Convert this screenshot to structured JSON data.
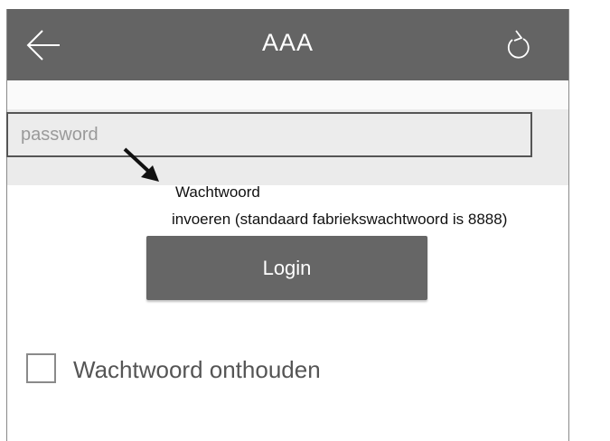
{
  "topbar": {
    "title": "AAA",
    "back_icon": "arrow-left-icon",
    "refresh_icon": "refresh-icon",
    "background": "#646464"
  },
  "password_field": {
    "placeholder": "password",
    "value": ""
  },
  "annotation": {
    "line1": "Wachtwoord",
    "line2": "invoeren (standaard fabriekswachtwoord is 8888)",
    "arrow_icon": "arrow-down-right-icon"
  },
  "login_button": {
    "label": "Login",
    "color": "#666666"
  },
  "remember": {
    "label": "Wachtwoord onthouden",
    "checked": false
  }
}
